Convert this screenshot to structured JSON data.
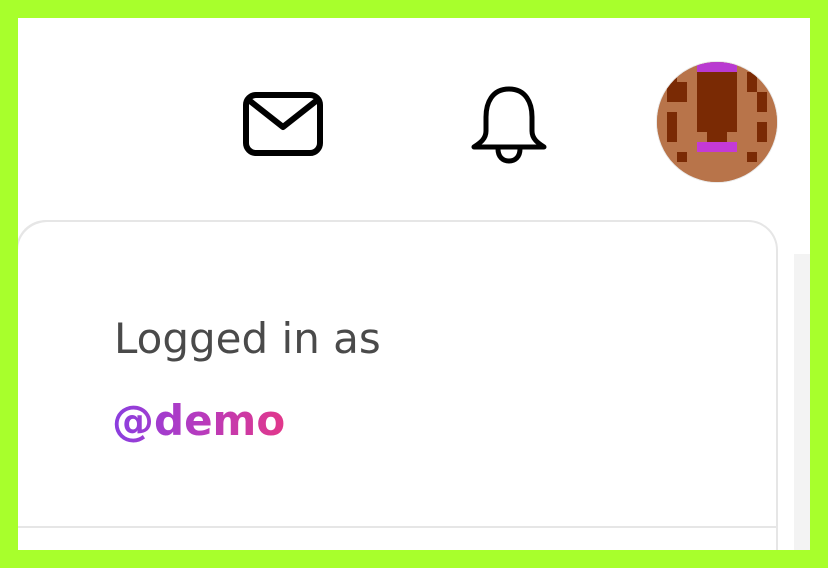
{
  "header": {
    "icons": [
      "mail-icon",
      "bell-icon"
    ],
    "avatar": "user-avatar"
  },
  "menu": {
    "logged_in_label": "Logged in as",
    "username": "@demo"
  },
  "colors": {
    "frame": "#a8ff2c",
    "username_gradient_start": "#8a3ee0",
    "username_gradient_end": "#e2388a"
  }
}
